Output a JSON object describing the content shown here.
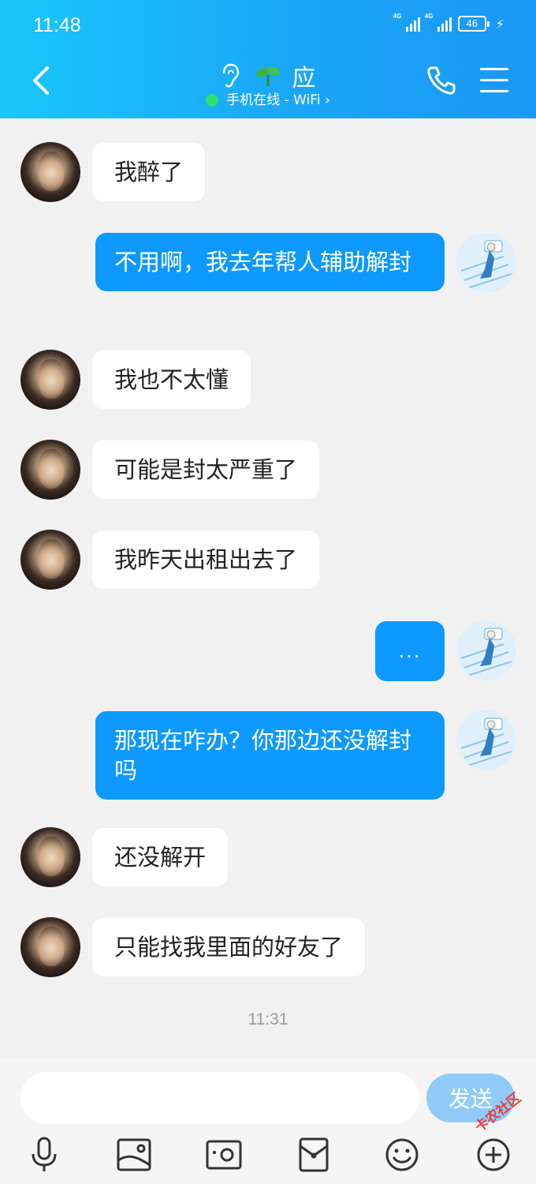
{
  "status_bar": {
    "time": "11:48",
    "net1": "4G",
    "net2": "4G",
    "battery": "46"
  },
  "header": {
    "title": "应",
    "online_status": "手机在线 - WiFi",
    "chevron": "›",
    "colors": {
      "gradient_start": "#19c7fb",
      "gradient_end": "#1a98f6",
      "online_dot": "#2ee06c"
    }
  },
  "messages": [
    {
      "side": "left",
      "text": "我醉了"
    },
    {
      "side": "right",
      "text": "不用啊，我去年帮人辅助解封"
    },
    {
      "side": "left",
      "text": "我也不太懂"
    },
    {
      "side": "left",
      "text": "可能是封太严重了"
    },
    {
      "side": "left",
      "text": "我昨天出租出去了"
    },
    {
      "side": "right",
      "text": "..."
    },
    {
      "side": "right",
      "text": "那现在咋办？你那边还没解封吗"
    },
    {
      "side": "left",
      "text": "还没解开"
    },
    {
      "side": "left",
      "text": "只能找我里面的好友了"
    }
  ],
  "timestamp": "11:31",
  "composer": {
    "input_value": "",
    "send_label": "发送"
  },
  "toolbar_icons": [
    "microphone-icon",
    "gallery-icon",
    "camera-icon",
    "red-envelope-icon",
    "emoji-icon",
    "plus-icon"
  ],
  "watermark": {
    "text": "卡农社区"
  }
}
